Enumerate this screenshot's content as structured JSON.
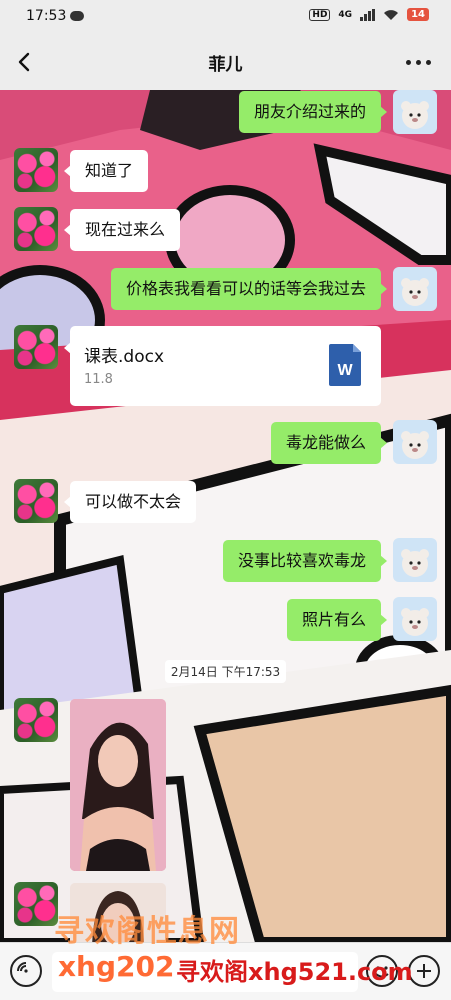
{
  "status_bar": {
    "time": "17:53",
    "hd_label": "HD",
    "network": "4G",
    "battery": "14"
  },
  "nav": {
    "title": "菲儿",
    "back_icon": "chevron-left-icon",
    "more_icon": "more-dots-icon"
  },
  "messages": [
    {
      "side": "right",
      "type": "text",
      "text": "朋友介绍过来的"
    },
    {
      "side": "left",
      "type": "text",
      "text": "知道了"
    },
    {
      "side": "left",
      "type": "text",
      "text": "现在过来么"
    },
    {
      "side": "right",
      "type": "text",
      "text": "价格表我看看可以的话等会我过去"
    },
    {
      "side": "left",
      "type": "file",
      "file_name": "课表.docx",
      "file_size": "11.8",
      "file_icon": "word-doc-icon",
      "file_icon_letter": "W"
    },
    {
      "side": "right",
      "type": "text",
      "text": "毒龙能做么"
    },
    {
      "side": "left",
      "type": "text",
      "text": "可以做不太会"
    },
    {
      "side": "right",
      "type": "text",
      "text": "没事比较喜欢毒龙"
    },
    {
      "side": "right",
      "type": "text",
      "text": "照片有么"
    },
    {
      "type": "timestamp",
      "text": "2月14日 下午17:53"
    },
    {
      "side": "left",
      "type": "image"
    },
    {
      "side": "left",
      "type": "image"
    }
  ],
  "input_bar": {
    "voice_icon": "voice-icon",
    "emoji_icon": "emoji-icon",
    "plus_icon": "plus-icon"
  },
  "watermark": {
    "line1": "寻欢阁性息网",
    "line2_prefix": "xhg202",
    "line2": "寻欢阁xhg521.com"
  },
  "colors": {
    "sent_bubble": "#95ec69",
    "received_bubble": "#ffffff",
    "background": "#ededed",
    "battery": "#e5533f"
  }
}
